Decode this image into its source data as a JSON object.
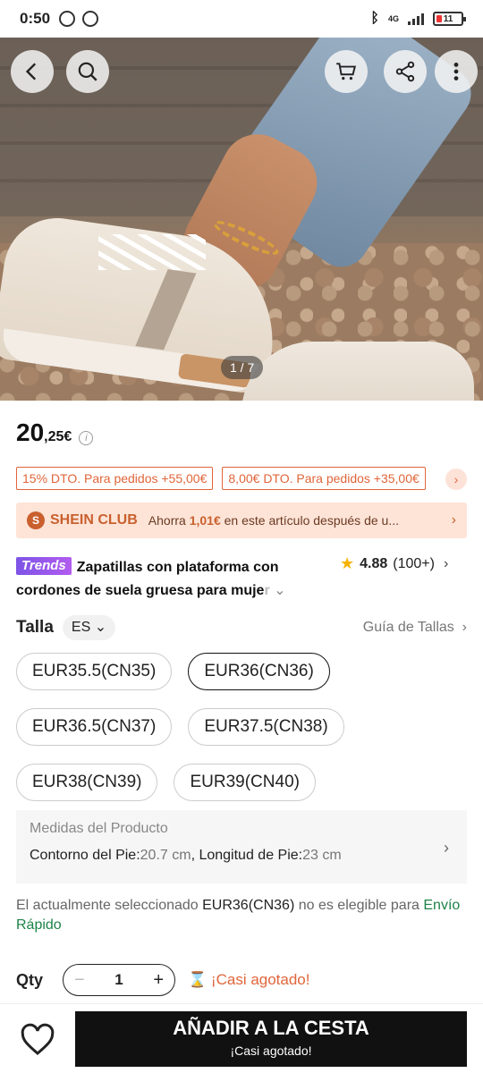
{
  "status": {
    "time": "0:50",
    "network": "4G",
    "battery": "11"
  },
  "gallery": {
    "pager": "1 / 7"
  },
  "price": {
    "main": "20",
    "cents": ",25€",
    "info_icon": "info-icon"
  },
  "coupons": [
    "15% DTO. Para pedidos +55,00€",
    "8,00€ DTO. Para pedidos +35,00€"
  ],
  "club": {
    "badge": "S",
    "name": "SHEIN CLUB",
    "text_prefix": "Ahorra ",
    "amount": "1,01€",
    "text_suffix": " en este artículo después de u..."
  },
  "product": {
    "tag": "Trends",
    "title_main": "Zapatillas con plataforma con cordones de suela gruesa para muje",
    "title_fade": "r",
    "rating": "4.88",
    "reviews": "(100+)"
  },
  "size": {
    "label": "Talla",
    "region": "ES",
    "guide": "Guía de Tallas",
    "options": [
      "EUR35.5(CN35)",
      "EUR36(CN36)",
      "EUR36.5(CN37)",
      "EUR37.5(CN38)",
      "EUR38(CN39)",
      "EUR39(CN40)"
    ],
    "selected": "EUR36(CN36)"
  },
  "measurements": {
    "header": "Medidas del Producto",
    "k1": "Contorno del Pie:",
    "v1": "20.7 cm",
    "sep": ", ",
    "k2": "Longitud de Pie:",
    "v2": "23 cm"
  },
  "notice": {
    "prefix": "El actualmente seleccionado ",
    "size": "EUR36(CN36)",
    "suffix": " no es elegible para ",
    "link": "Envío Rápido"
  },
  "qty": {
    "label": "Qty",
    "value": "1",
    "minus": "−",
    "plus": "+",
    "low_stock": "¡Casi agotado!"
  },
  "cta": {
    "main": "AÑADIR A LA CESTA",
    "sub": "¡Casi agotado!"
  },
  "colors": {
    "accent": "#e0653a",
    "club_bg": "#fde4d7",
    "link_green": "#1d8448",
    "trends_purple": "#7d54e6"
  }
}
